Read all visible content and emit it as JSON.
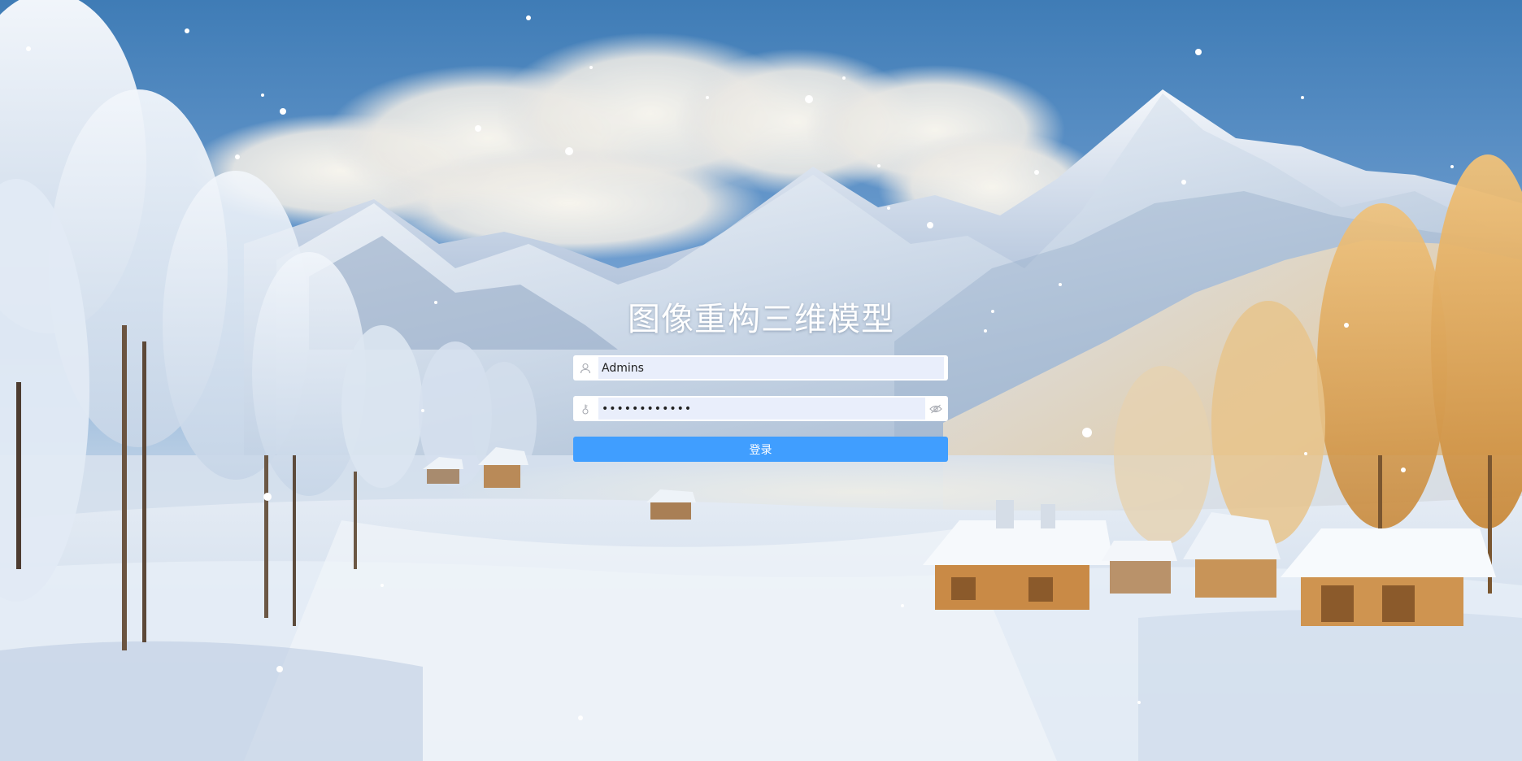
{
  "login": {
    "title": "图像重构三维模型",
    "username": {
      "value": "Admins",
      "icon": "user-icon"
    },
    "password": {
      "value": "••••••••••••",
      "icon": "lock-icon",
      "toggle_icon": "eye-hidden-icon"
    },
    "submit_label": "登录"
  },
  "colors": {
    "primary": "#409eff",
    "input_background": "#e9eefb",
    "title": "#ffffff"
  }
}
